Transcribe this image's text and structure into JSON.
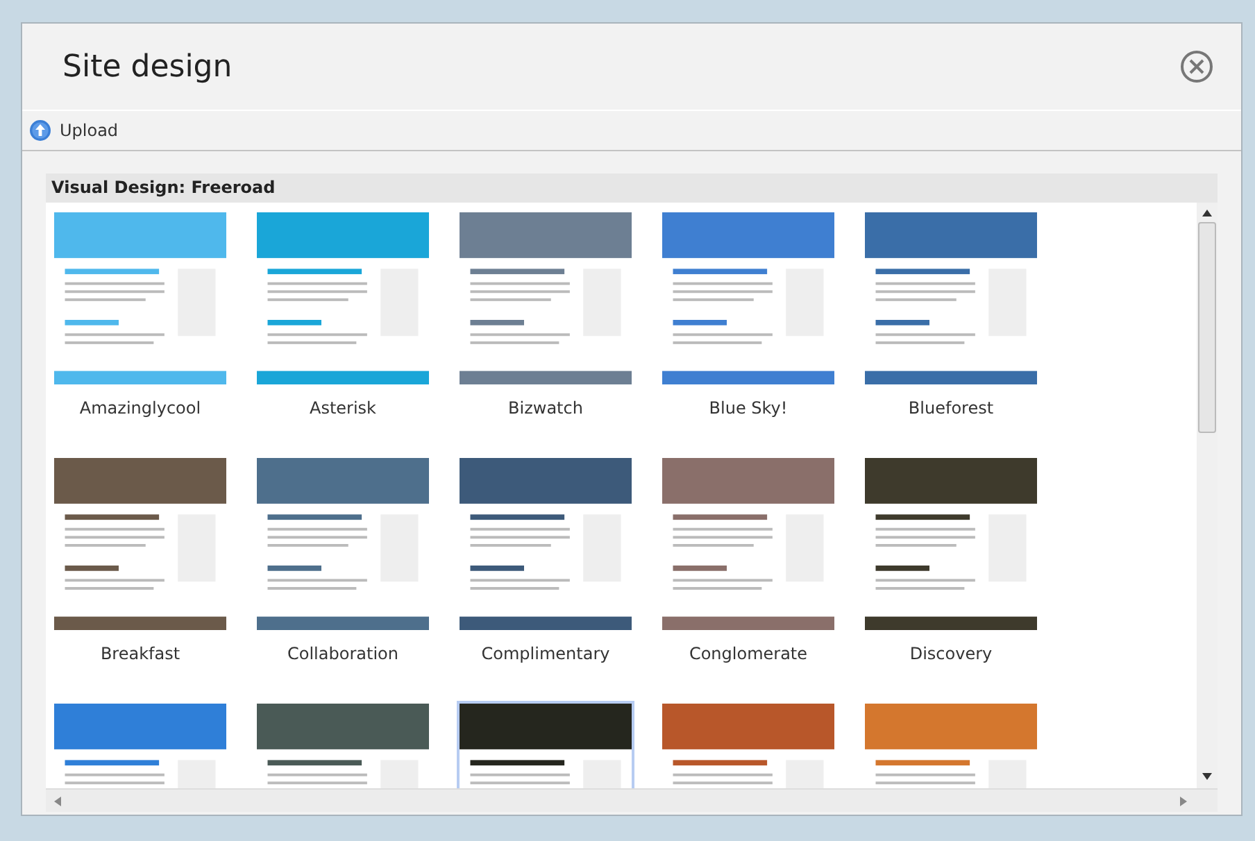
{
  "dialog": {
    "title": "Site design"
  },
  "toolbar": {
    "upload": "Upload"
  },
  "section": {
    "title": "Visual Design: Freeroad"
  },
  "designs": [
    {
      "label": "Amazinglycool",
      "selected": false,
      "color": "#4fb8ec"
    },
    {
      "label": "Asterisk",
      "selected": false,
      "color": "#1aa6d8"
    },
    {
      "label": "Bizwatch",
      "selected": false,
      "color": "#6d7f93"
    },
    {
      "label": "Blue Sky!",
      "selected": false,
      "color": "#3f7fd1"
    },
    {
      "label": "Blueforest",
      "selected": false,
      "color": "#3a6ea8"
    },
    {
      "label": "Breakfast",
      "selected": false,
      "color": "#6b5a4a"
    },
    {
      "label": "Collaboration",
      "selected": false,
      "color": "#4e6f8c"
    },
    {
      "label": "Complimentary",
      "selected": false,
      "color": "#3d5a7a"
    },
    {
      "label": "Conglomerate",
      "selected": false,
      "color": "#8a6f6a"
    },
    {
      "label": "Discovery",
      "selected": false,
      "color": "#3e3a2c"
    },
    {
      "selected": false,
      "color": "#2f7fd8"
    },
    {
      "selected": false,
      "color": "#4a5a56"
    },
    {
      "selected": true,
      "color": "#25261e"
    },
    {
      "selected": false,
      "color": "#b8572a"
    },
    {
      "selected": false,
      "color": "#d4772e"
    }
  ]
}
